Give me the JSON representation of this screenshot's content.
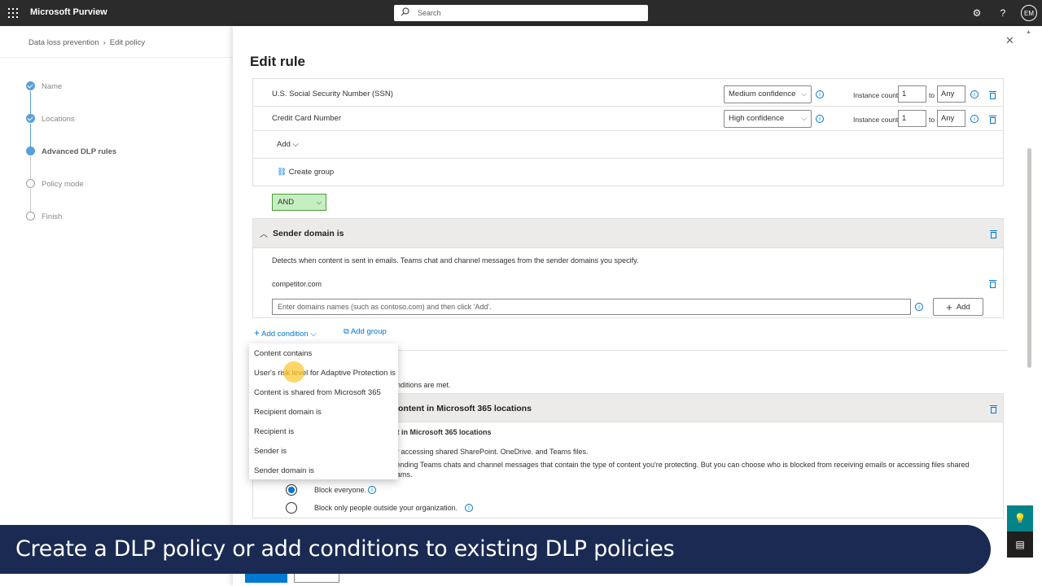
{
  "app": {
    "brand": "Microsoft Purview",
    "search_placeholder": "Search",
    "avatar_initials": "EM"
  },
  "breadcrumb": [
    "Data loss prevention",
    "Edit policy"
  ],
  "wizard_steps": [
    {
      "label": "Name",
      "state": "done"
    },
    {
      "label": "Locations",
      "state": "done"
    },
    {
      "label": "Advanced DLP rules",
      "state": "current"
    },
    {
      "label": "Policy mode",
      "state": "todo"
    },
    {
      "label": "Finish",
      "state": "todo"
    }
  ],
  "panel": {
    "title": "Edit rule",
    "sensitive_types": [
      {
        "name": "U.S. Social Security Number (SSN)",
        "confidence": "Medium confidence",
        "instance_label": "Instance count",
        "min": "1",
        "to": "to",
        "max": "Any"
      },
      {
        "name": "Credit Card Number",
        "confidence": "High confidence",
        "instance_label": "Instance count",
        "min": "1",
        "to": "to",
        "max": "Any"
      }
    ],
    "add_label": "Add",
    "create_group_label": "Create group",
    "operator": "AND",
    "sender_section": {
      "title": "Sender domain is",
      "description": "Detects when content is sent in emails. Teams chat and channel messages from the sender domains you specify.",
      "domain": "competitor.com",
      "input_placeholder": "Enter domains names (such as contoso.com) and then click 'Add'.",
      "add_button": "Add"
    },
    "add_condition_label": "Add condition",
    "add_group_label": "Add group",
    "condition_menu": [
      "Content contains",
      "User's risk level for Adaptive Protection is",
      "Content is shared from Microsoft 365",
      "Recipient domain is",
      "Recipient is",
      "Sender is",
      "Sender domain is"
    ],
    "partial_texts": {
      "conditions_met": "onditions are met.",
      "restrict_header": "ontent in Microsoft 365 locations",
      "restrict_sub": "nt in Microsoft 365 locations",
      "restrict_desc1": "or accessing shared SharePoint. OneDrive. and Teams files.",
      "restrict_desc2": "sending Teams chats and channel messages that contain the type of content you're protecting. But you can choose who is blocked from receiving emails or accessing files shared",
      "restrict_desc3": "eams."
    },
    "radio_options": [
      {
        "label": "Block everyone.",
        "checked": true
      },
      {
        "label": "Block only people outside your organization.",
        "checked": false
      }
    ]
  },
  "banner": {
    "text": "Create a DLP policy or add conditions to existing DLP policies"
  },
  "colors": {
    "topbar": "#2b2b2b",
    "accent": "#0078d4",
    "banner": "#1a2a52",
    "and_bg": "#c5eec1",
    "side_btn": "#038387"
  }
}
